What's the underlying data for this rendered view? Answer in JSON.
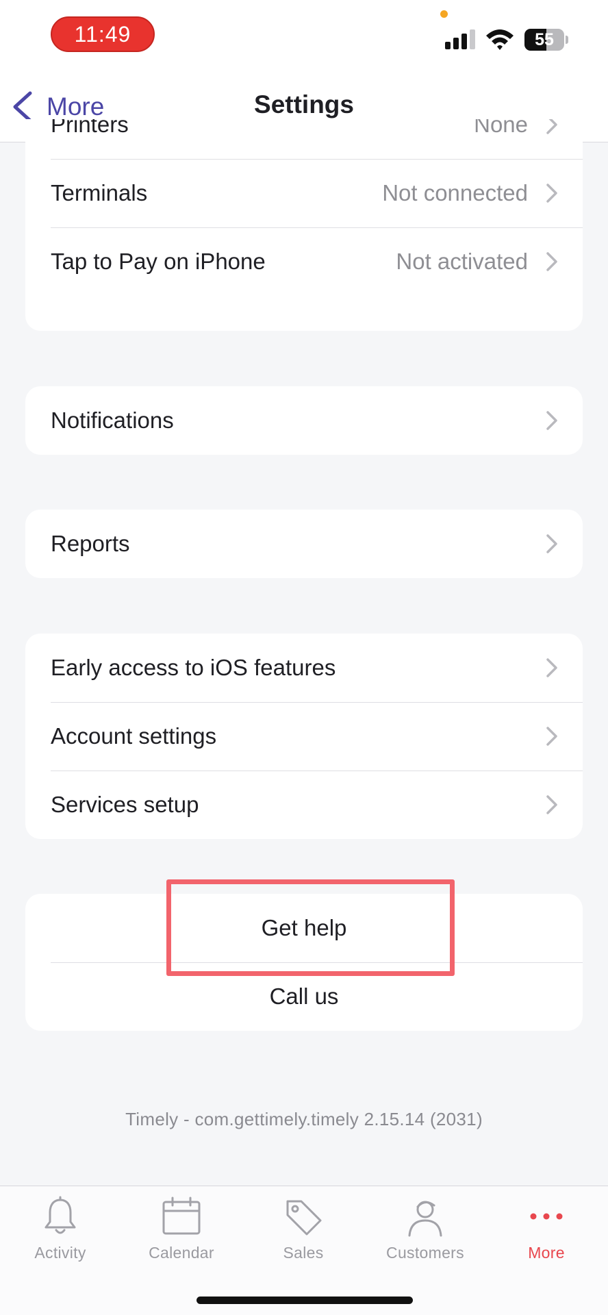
{
  "status_bar": {
    "time": "11:49",
    "battery_level": "55",
    "signal_bars_active": 3,
    "signal_bars_total": 4
  },
  "nav": {
    "back_label": "More",
    "title": "Settings"
  },
  "hardware_group": [
    {
      "label": "Printers",
      "value": "None"
    },
    {
      "label": "Terminals",
      "value": "Not connected"
    },
    {
      "label": "Tap to Pay on iPhone",
      "value": "Not activated"
    }
  ],
  "notifications_group": [
    {
      "label": "Notifications"
    }
  ],
  "reports_group": [
    {
      "label": "Reports"
    }
  ],
  "account_group": [
    {
      "label": "Early access to iOS features"
    },
    {
      "label": "Account settings"
    },
    {
      "label": "Services setup"
    }
  ],
  "help_group": [
    {
      "label": "Get help"
    },
    {
      "label": "Call us"
    }
  ],
  "version_text": "Timely - com.gettimely.timely 2.15.14 (2031)",
  "tabs": [
    {
      "label": "Activity",
      "icon": "bell-icon",
      "active": false
    },
    {
      "label": "Calendar",
      "icon": "calendar-icon",
      "active": false
    },
    {
      "label": "Sales",
      "icon": "tag-icon",
      "active": false
    },
    {
      "label": "Customers",
      "icon": "person-icon",
      "active": false
    },
    {
      "label": "More",
      "icon": "more-dots-icon",
      "active": true
    }
  ],
  "colors": {
    "accent": "#4b46a6",
    "active_tab": "#e8474e",
    "time_pill": "#e8332e",
    "highlight": "#f2646c",
    "background": "#f5f6f8"
  }
}
